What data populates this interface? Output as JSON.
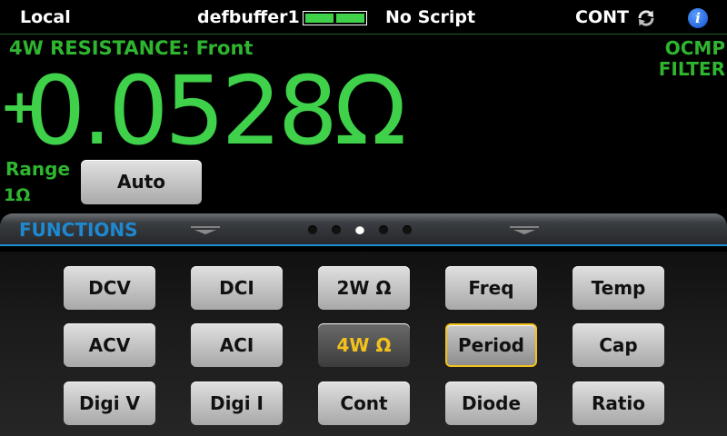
{
  "status_bar": {
    "local": "Local",
    "buffer": "defbuffer1",
    "script": "No Script",
    "trigger_mode": "CONT",
    "buffer_fill_fraction": 1.0,
    "icons": [
      "refresh-icon",
      "info-icon"
    ],
    "info_glyph": "i"
  },
  "measurement": {
    "function_label": "4W RESISTANCE: Front",
    "indicators": [
      "OCMP",
      "FILTER"
    ],
    "sign": "+",
    "value": "0.0528Ω",
    "range_label": "Range",
    "range_value": "1Ω",
    "range_button": "Auto"
  },
  "functions": {
    "title": "FUNCTIONS",
    "page_count": 5,
    "active_page": 3,
    "buttons": [
      [
        "DCV",
        "DCI",
        "2W Ω",
        "Freq",
        "Temp"
      ],
      [
        "ACV",
        "ACI",
        "4W Ω",
        "Period",
        "Cap"
      ],
      [
        "Digi V",
        "Digi I",
        "Cont",
        "Diode",
        "Ratio"
      ]
    ],
    "active_button": "4W Ω",
    "focused_button": "Period"
  },
  "colors": {
    "reading_green": "#3fd14a",
    "label_green": "#2fb52f",
    "accent_blue": "#1b8fd6",
    "active_yellow": "#f2c21b"
  }
}
